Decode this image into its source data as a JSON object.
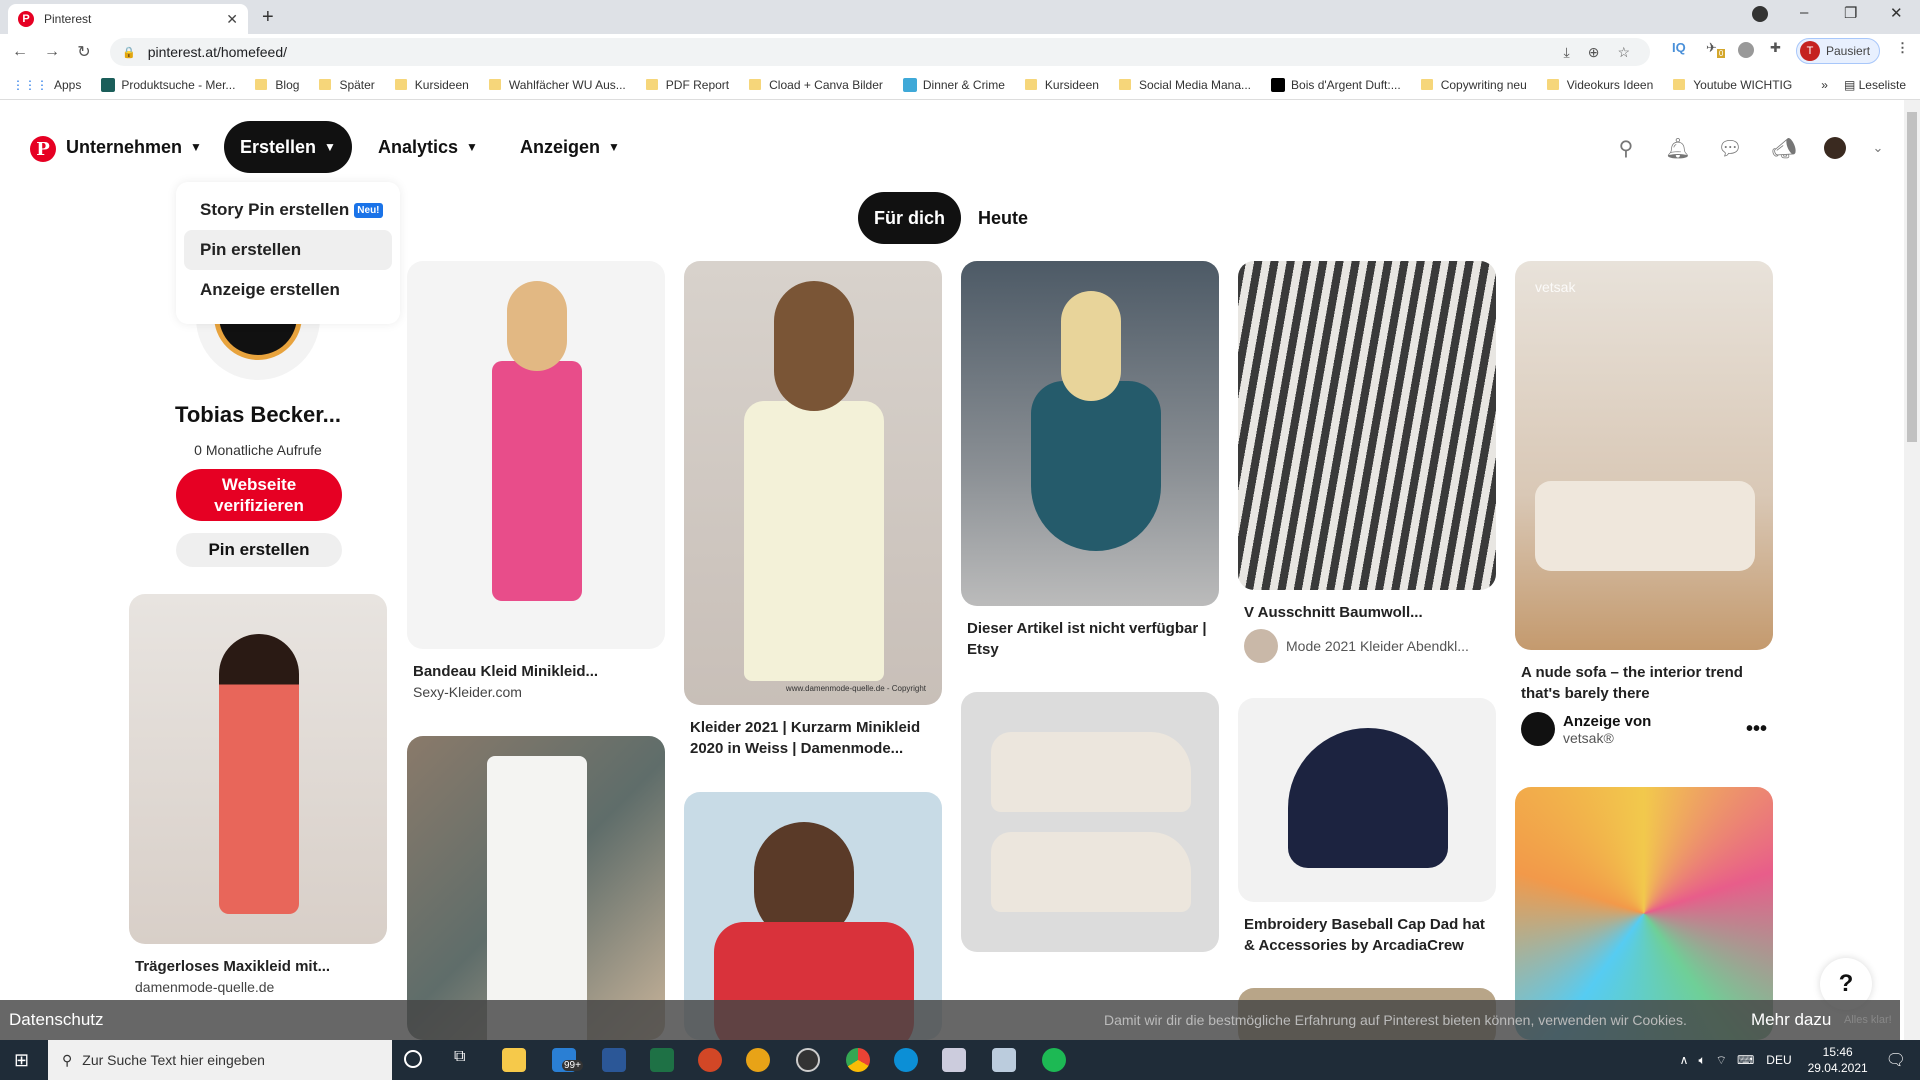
{
  "browser": {
    "tab_title": "Pinterest",
    "url": "pinterest.at/homefeed/",
    "profile_label": "Pausiert",
    "profile_initial": "T",
    "extension_badge": "0",
    "window_controls": {
      "minimize": "–",
      "restore": "❐",
      "close": "✕"
    },
    "bookmarks": [
      {
        "label": "Apps",
        "type": "apps"
      },
      {
        "label": "Produktsuche - Mer...",
        "type": "site"
      },
      {
        "label": "Blog",
        "type": "folder"
      },
      {
        "label": "Später",
        "type": "folder"
      },
      {
        "label": "Kursideen",
        "type": "folder"
      },
      {
        "label": "Wahlfächer WU Aus...",
        "type": "folder"
      },
      {
        "label": "PDF Report",
        "type": "folder"
      },
      {
        "label": "Cload + Canva Bilder",
        "type": "folder"
      },
      {
        "label": "Dinner & Crime",
        "type": "site"
      },
      {
        "label": "Kursideen",
        "type": "folder"
      },
      {
        "label": "Social Media Mana...",
        "type": "folder"
      },
      {
        "label": "Bois d'Argent Duft:...",
        "type": "site"
      },
      {
        "label": "Copywriting neu",
        "type": "folder"
      },
      {
        "label": "Videokurs Ideen",
        "type": "folder"
      },
      {
        "label": "Youtube WICHTIG",
        "type": "folder"
      }
    ],
    "bookmarks_overflow": "»",
    "reading_list": "Leseliste"
  },
  "header": {
    "nav": [
      {
        "label": "Unternehmen"
      },
      {
        "label": "Erstellen",
        "active": true
      },
      {
        "label": "Analytics"
      },
      {
        "label": "Anzeigen"
      }
    ],
    "icons": [
      "search-icon",
      "bell-icon",
      "messages-icon",
      "megaphone-icon",
      "avatar",
      "chevron-down-icon"
    ]
  },
  "create_menu": {
    "items": [
      {
        "label": "Story Pin erstellen",
        "badge": "Neu!"
      },
      {
        "label": "Pin erstellen",
        "hover": true
      },
      {
        "label": "Anzeige erstellen"
      }
    ]
  },
  "profile": {
    "name": "Tobias Becker...",
    "monthly_views": "0 Monatliche Aufrufe",
    "verify_button": "Webseite verifizieren",
    "create_pin_button": "Pin erstellen"
  },
  "feed_tabs": [
    {
      "label": "Für dich",
      "active": true
    },
    {
      "label": "Heute"
    }
  ],
  "pins": [
    {
      "title": "Trägerloses Maxikleid mit...",
      "source": "damenmode-quelle.de"
    },
    {
      "title": "Bandeau Kleid Minikleid...",
      "source": "Sexy-Kleider.com"
    },
    {
      "title": "Kleider 2021 | Kurzarm Minikleid 2020 in Weiss | Damenmode...",
      "source": "",
      "watermark": "www.damenmode-quelle.de - Copyright"
    },
    {
      "title": "Dieser Artikel ist nicht verfügbar | Etsy",
      "source": ""
    },
    {
      "title": "V Ausschnitt Baumwoll...",
      "source": "Mode 2021 Kleider Abendkl..."
    },
    {
      "title": "A nude sofa – the interior trend that's barely there",
      "ad_label": "Anzeige von",
      "advertiser": "vetsak®",
      "image_watermark": "vetsak"
    },
    {
      "title": "Embroidery Baseball Cap Dad hat & Accessories by ArcadiaCrew",
      "source": ""
    }
  ],
  "cookie_banner": {
    "left_link": "Datenschutz",
    "message": "Damit wir dir die bestmögliche Erfahrung auf Pinterest bieten können, verwenden wir Cookies.",
    "more_link": "Mehr dazu",
    "accept": "Alles klar!"
  },
  "help_button": "?",
  "taskbar": {
    "search_placeholder": "Zur Suche Text hier eingeben",
    "mail_badge": "99+",
    "language": "DEU",
    "time": "15:46",
    "date": "29.04.2021"
  }
}
